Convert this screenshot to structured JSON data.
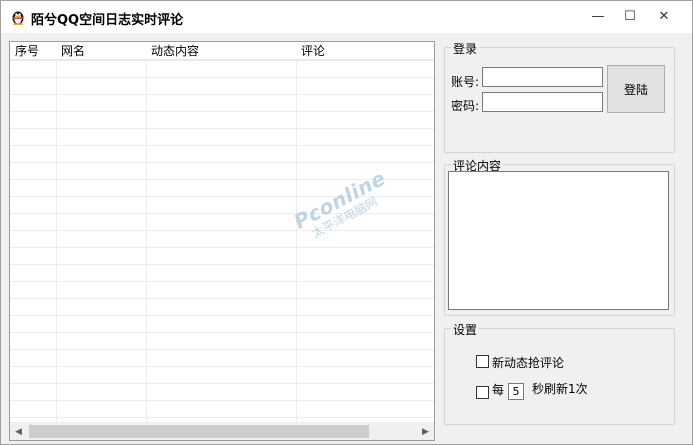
{
  "window": {
    "title": "陌兮QQ空间日志实时评论",
    "app_icon": "qq-penguin-icon",
    "min_symbol": "—",
    "max_symbol": "☐",
    "close_symbol": "✕"
  },
  "list": {
    "columns": [
      "序号",
      "网名",
      "动态内容",
      "评论"
    ],
    "scroll_left": "◀",
    "scroll_right": "▶"
  },
  "watermark": {
    "main": "Pconline",
    "sub": "太平洋电脑网"
  },
  "login": {
    "group_title": "登录",
    "account_label": "账号:",
    "account_value": "",
    "password_label": "密码:",
    "password_value": "",
    "login_button": "登陆"
  },
  "comment": {
    "group_title": "评论内容",
    "text": ""
  },
  "settings": {
    "group_title": "设置",
    "grab_comment_label": "新动态抢评论",
    "grab_comment_checked": false,
    "refresh_prefix": "每",
    "refresh_interval": "5",
    "refresh_suffix": "秒刷新1次",
    "refresh_checked": false
  },
  "colors": {
    "window_bg": "#f0f0f0",
    "title_bg": "#ffffff",
    "grid_line": "#ececec",
    "watermark": "#a9c8e0"
  }
}
